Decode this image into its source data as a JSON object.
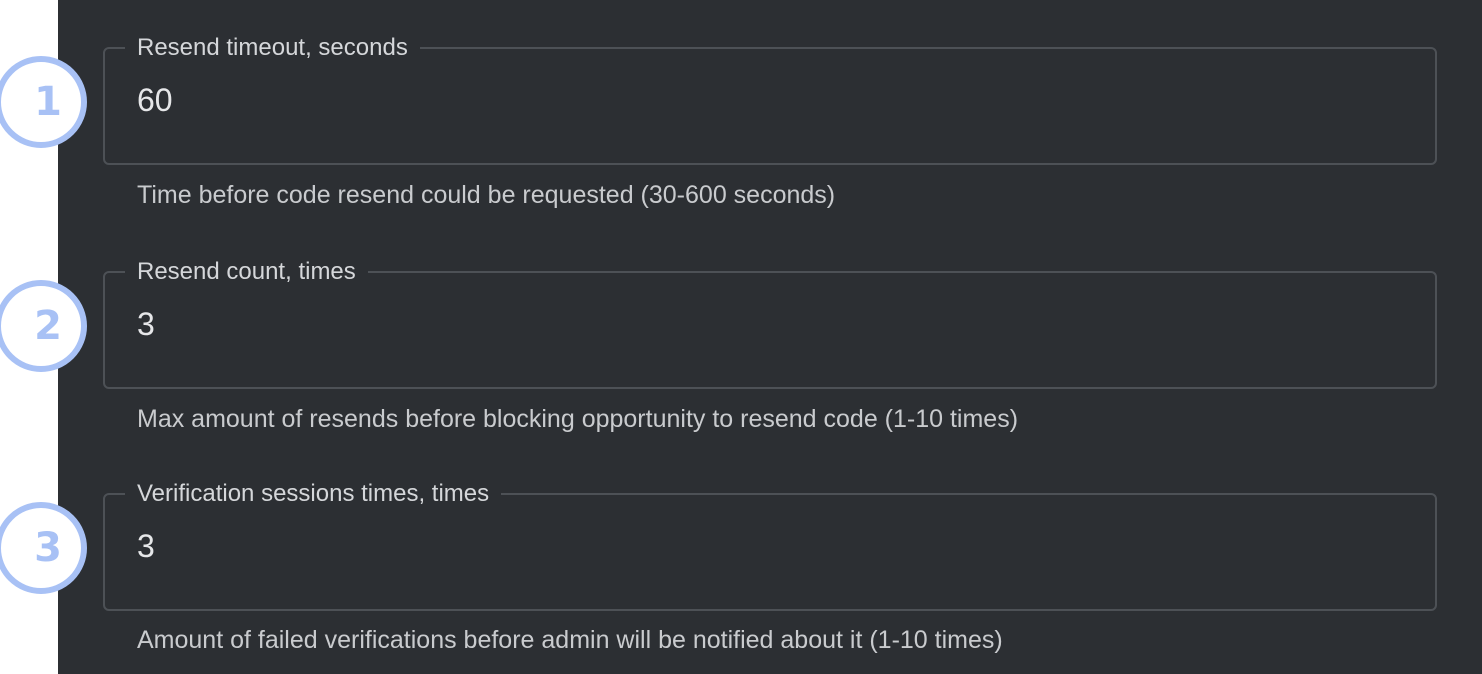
{
  "fields": [
    {
      "label": "Resend timeout, seconds",
      "value": "60",
      "helper": "Time before code resend could be requested (30-600 seconds)",
      "badge": "1"
    },
    {
      "label": "Resend count, times",
      "value": "3",
      "helper": "Max amount of resends before blocking opportunity to resend code (1-10 times)",
      "badge": "2"
    },
    {
      "label": "Verification sessions times, times",
      "value": "3",
      "helper": "Amount of failed verifications before admin will be notified about it (1-10 times)",
      "badge": "3"
    }
  ],
  "colors": {
    "panel_background": "#2c2f33",
    "field_border": "#4d5156",
    "badge_accent": "#a8c1f5"
  }
}
